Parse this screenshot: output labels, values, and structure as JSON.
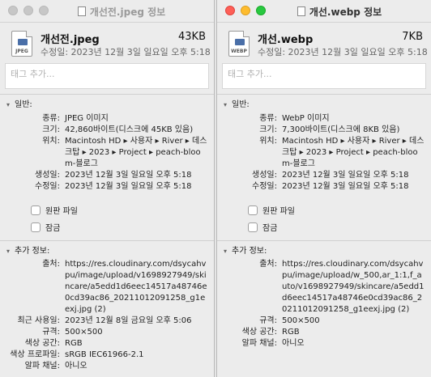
{
  "left": {
    "title": "개선전.jpeg 정보",
    "file_name": "개선전.jpeg",
    "file_size": "43KB",
    "modified_line": "수정일: 2023년 12월 3일 일요일 오후 5:18",
    "icon_ext": "JPEG",
    "tags_placeholder": "태그 추가...",
    "general_label": "일반:",
    "general": [
      {
        "k": "종류:",
        "v": "JPEG 이미지"
      },
      {
        "k": "크기:",
        "v": "42,860바이트(디스크에 45KB 있음)"
      },
      {
        "k": "위치:",
        "v": "Macintosh HD ▸ 사용자 ▸ River ▸ 데스크탑 ▸ 2023 ▸ Project ▸ peach-bloom-블로그"
      },
      {
        "k": "생성일:",
        "v": "2023년 12월 3일 일요일 오후 5:18"
      },
      {
        "k": "수정일:",
        "v": "2023년 12월 3일 일요일 오후 5:18"
      }
    ],
    "stationery_label": "원판 파일",
    "locked_label": "잠금",
    "more_label": "추가 정보:",
    "more": [
      {
        "k": "출처:",
        "v": "https://res.cloudinary.com/dsycahvpu/image/upload/v1698927949/skincare/a5edd1d6eec14517a48746e0cd39ac86_20211012091258_g1eexj.jpg (2)"
      },
      {
        "k": "최근 사용일:",
        "v": "2023년 12월 8일 금요일 오후 5:06"
      },
      {
        "k": "규격:",
        "v": "500×500"
      },
      {
        "k": "색상 공간:",
        "v": "RGB"
      },
      {
        "k": "색상 프로파일:",
        "v": "sRGB IEC61966-2.1"
      },
      {
        "k": "알파 채널:",
        "v": "아니오"
      }
    ]
  },
  "right": {
    "title": "개선.webp 정보",
    "file_name": "개선.webp",
    "file_size": "7KB",
    "modified_line": "수정일: 2023년 12월 3일 일요일 오후 5:18",
    "icon_ext": "WEBP",
    "tags_placeholder": "태그 추가...",
    "general_label": "일반:",
    "general": [
      {
        "k": "종류:",
        "v": "WebP 이미지"
      },
      {
        "k": "크기:",
        "v": "7,300바이트(디스크에 8KB 있음)"
      },
      {
        "k": "위치:",
        "v": "Macintosh HD ▸ 사용자 ▸ River ▸ 데스크탑 ▸ 2023 ▸ Project ▸ peach-bloom-블로그"
      },
      {
        "k": "생성일:",
        "v": "2023년 12월 3일 일요일 오후 5:18"
      },
      {
        "k": "수정일:",
        "v": "2023년 12월 3일 일요일 오후 5:18"
      }
    ],
    "stationery_label": "원판 파일",
    "locked_label": "잠금",
    "more_label": "추가 정보:",
    "more": [
      {
        "k": "출처:",
        "v": "https://res.cloudinary.com/dsycahvpu/image/upload/w_500,ar_1:1,f_auto/v1698927949/skincare/a5edd1d6eec14517a48746e0cd39ac86_20211012091258_g1eexj.jpg (2)"
      },
      {
        "k": "규격:",
        "v": "500×500"
      },
      {
        "k": "색상 공간:",
        "v": "RGB"
      },
      {
        "k": "알파 채널:",
        "v": "아니오"
      }
    ]
  }
}
